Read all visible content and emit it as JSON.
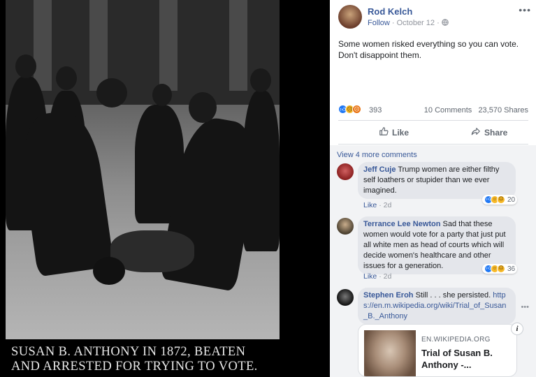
{
  "photo": {
    "caption_line1": "Susan B. Anthony in 1872, beaten",
    "caption_line2": "and arrested for trying to vote."
  },
  "post": {
    "author": "Rod Kelch",
    "follow_label": "Follow",
    "date": "October 12",
    "audience_icon": "globe-icon",
    "text_line1": "Some women risked everything so you can vote.",
    "text_line2": "Don't disappoint them.",
    "reaction_count": "393",
    "reactions": [
      "like",
      "sad",
      "angry"
    ],
    "comments_count": "10 Comments",
    "shares_count": "23,570 Shares",
    "like_label": "Like",
    "share_label": "Share"
  },
  "comments_section": {
    "view_more": "View 4 more comments",
    "comments": [
      {
        "name": "Jeff Cuje",
        "text": "Trump women are either filthy self loathers or stupider than we ever imagined.",
        "like": "Like",
        "time": "2d",
        "reaction_count": "20",
        "reactions": [
          "like",
          "haha",
          "sad"
        ]
      },
      {
        "name": "Terrance Lee Newton",
        "text": "Sad that these women would vote for a party that just put all white men as head of courts which will decide women's healthcare and other issues for a generation.",
        "like": "Like",
        "time": "2d",
        "reaction_count": "36",
        "reactions": [
          "like",
          "haha",
          "sad"
        ]
      },
      {
        "name": "Stephen Eroh",
        "text": "Still . . . she persisted.",
        "link": "https://en.m.wikipedia.org/wiki/Trial_of_Susan_B._Anthony"
      }
    ],
    "link_card": {
      "domain": "EN.WIKIPEDIA.ORG",
      "title": "Trial of Susan B. Anthony -..."
    }
  },
  "colors": {
    "link_blue": "#385898",
    "bubble_gray": "#e4e6eb",
    "like_blue": "#2078f4"
  }
}
